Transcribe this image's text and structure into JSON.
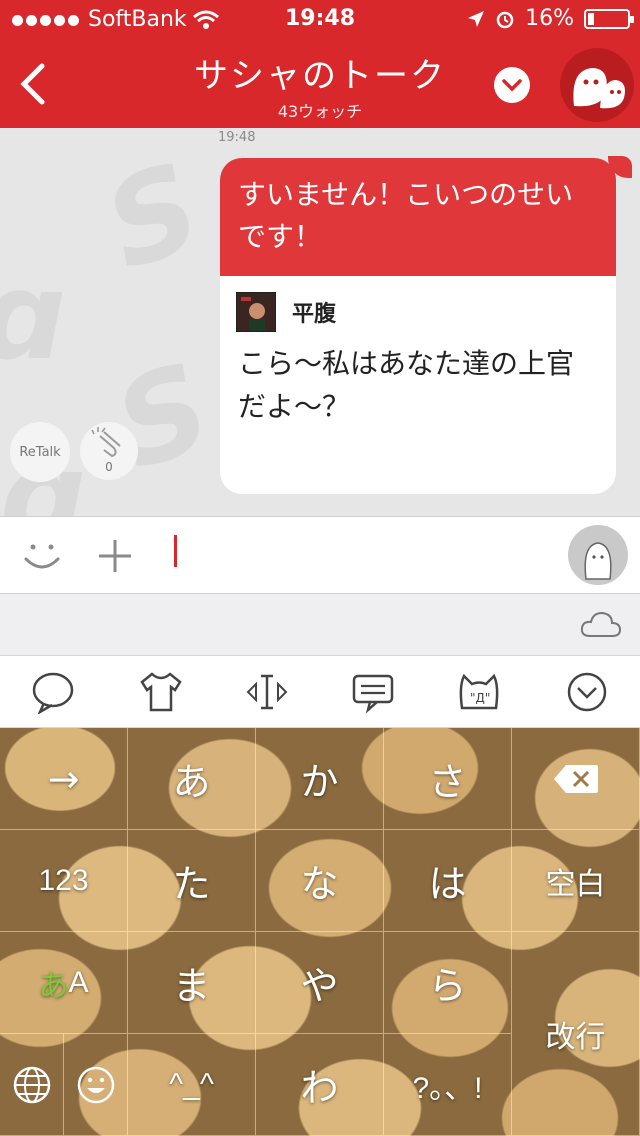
{
  "status_bar": {
    "carrier": "SoftBank",
    "time": "19:48",
    "battery_percent": "16%",
    "battery_level": 0.16
  },
  "header": {
    "title": "サシャのトーク",
    "subtitle": "43ウォッチ"
  },
  "chat": {
    "timestamp": "19:48",
    "retalk_label": "ReTalk",
    "clap_count": "0",
    "message": {
      "text": "すいません！こいつのせいです！",
      "quote_name": "平腹",
      "quote_text": "こら〜私はあなた達の上官だよ〜？"
    }
  },
  "keyboard": {
    "rows": [
      [
        "→",
        "あ",
        "か",
        "さ",
        "⌫"
      ],
      [
        "123",
        "た",
        "な",
        "は",
        "空白"
      ],
      [
        "あA",
        "ま",
        "や",
        "ら",
        "改行"
      ],
      [
        "🌐 ☺",
        "^_^",
        "わ",
        "?。、!",
        ""
      ]
    ],
    "key_arrow": "→",
    "key_a": "あ",
    "key_ka": "か",
    "key_sa": "さ",
    "key_123": "123",
    "key_ta": "た",
    "key_na": "な",
    "key_ha": "は",
    "key_space": "空白",
    "key_aA_kana": "あ",
    "key_aA_latin": "A",
    "key_ma": "ま",
    "key_ya": "や",
    "key_ra": "ら",
    "key_return": "改行",
    "key_kaomoji": "^_^",
    "key_wa": "わ",
    "key_punct": "?。、!"
  },
  "colors": {
    "brand_red": "#d8282c",
    "bubble_red": "#e0373b",
    "aA_green": "#7ccc3a"
  },
  "icons": [
    "back-chevron-icon",
    "dropdown-chevron-icon",
    "smiley-icon",
    "plus-icon",
    "cloud-icon",
    "chat-bubble-icon",
    "tshirt-icon",
    "text-cursor-icon",
    "comment-icon",
    "cat-face-icon",
    "chevron-circle-icon",
    "globe-icon",
    "emoji-icon",
    "delete-icon"
  ]
}
